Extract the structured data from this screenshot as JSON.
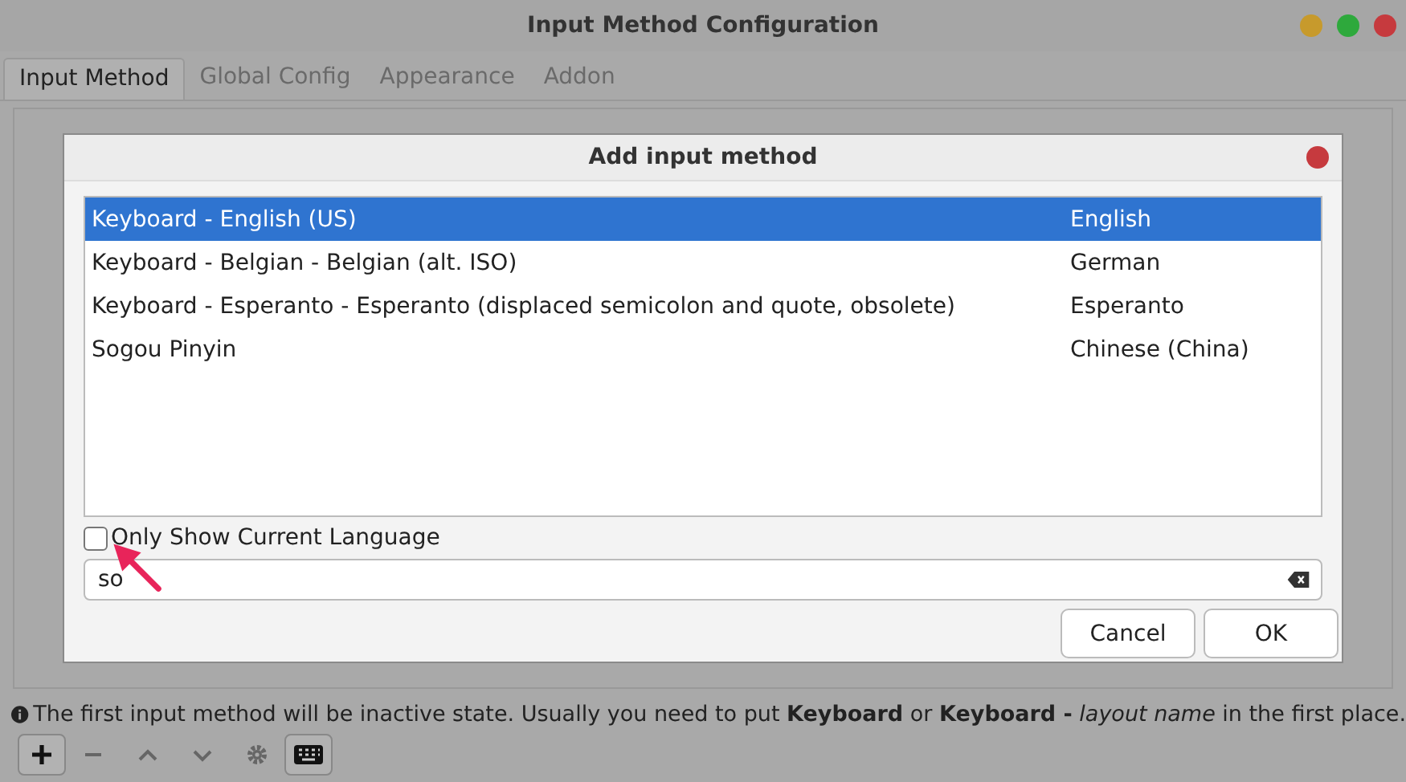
{
  "window": {
    "title": "Input Method Configuration"
  },
  "tabs": [
    {
      "label": "Input Method",
      "selected": true
    },
    {
      "label": "Global Config",
      "selected": false
    },
    {
      "label": "Appearance",
      "selected": false
    },
    {
      "label": "Addon",
      "selected": false
    }
  ],
  "dialog": {
    "title": "Add input method",
    "rows": [
      {
        "name": "Keyboard - English (US)",
        "language": "English",
        "selected": true
      },
      {
        "name": "Keyboard - Belgian - Belgian (alt. ISO)",
        "language": "German",
        "selected": false
      },
      {
        "name": "Keyboard - Esperanto - Esperanto (displaced semicolon and quote, obsolete)",
        "language": "Esperanto",
        "selected": false
      },
      {
        "name": "Sogou Pinyin",
        "language": "Chinese (China)",
        "selected": false
      }
    ],
    "only_current_language": {
      "label": "Only Show Current Language",
      "checked": false
    },
    "search": {
      "value": "so"
    },
    "buttons": [
      "Cancel",
      "OK"
    ]
  },
  "info": "The first input method will be inactive state. Usually you need to put **Keyboard** or **Keyboard -** *layout name* in the first place."
}
